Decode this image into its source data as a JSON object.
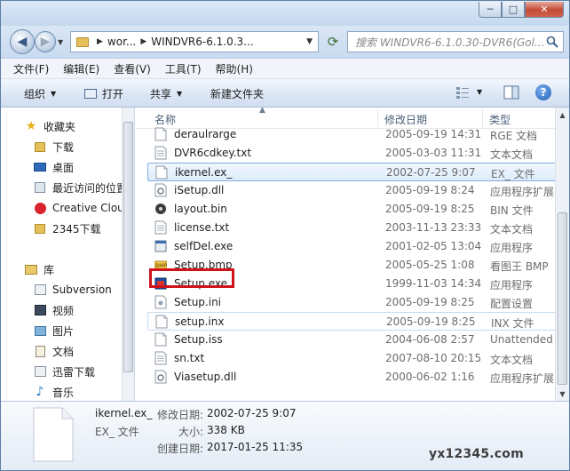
{
  "titlebar": {
    "minimize_glyph": "─",
    "maximize_glyph": "□",
    "close_glyph": "✕"
  },
  "nav": {
    "back_glyph": "◀",
    "forward_glyph": "▶",
    "history_glyph": "▼",
    "address_segments": [
      "wor...",
      "WINDVR6-6.1.0.3..."
    ],
    "address_separator": "▶",
    "address_dropdown_glyph": "▼",
    "refresh_glyph": "⟳",
    "search_placeholder": "搜索 WINDVR6-6.1.0.30-DVR6(Gol..."
  },
  "menu": {
    "items": [
      "文件(F)",
      "编辑(E)",
      "查看(V)",
      "工具(T)",
      "帮助(H)"
    ]
  },
  "toolbar": {
    "organize": "组织",
    "open": "打开",
    "share": "共享",
    "new_folder": "新建文件夹",
    "dropdown_glyph": "▼",
    "help_glyph": "?"
  },
  "sidebar": {
    "items": [
      {
        "label": "收藏夹",
        "icon": "star-icon"
      },
      {
        "label": "下载",
        "icon": "folder-icon"
      },
      {
        "label": "桌面",
        "icon": "desktop-icon"
      },
      {
        "label": "最近访问的位置",
        "icon": "recent-icon"
      },
      {
        "label": "Creative Cloud",
        "icon": "creative-cloud-icon"
      },
      {
        "label": "2345下载",
        "icon": "folder-icon"
      },
      {
        "label": "库",
        "icon": "library-icon"
      },
      {
        "label": "Subversion",
        "icon": "library-folder-icon"
      },
      {
        "label": "视频",
        "icon": "video-icon"
      },
      {
        "label": "图片",
        "icon": "pictures-icon"
      },
      {
        "label": "文档",
        "icon": "documents-icon"
      },
      {
        "label": "迅雷下载",
        "icon": "library-folder-icon"
      },
      {
        "label": "音乐",
        "icon": "music-icon"
      }
    ]
  },
  "columns": {
    "name": "名称",
    "modified": "修改日期",
    "type": "类型"
  },
  "files": [
    {
      "name": "deraulrarge",
      "date": "2005-09-19 14:31",
      "type": "RGE 文档",
      "icon": "generic-file-icon"
    },
    {
      "name": "DVR6cdkey.txt",
      "date": "2005-03-03 11:31",
      "type": "文本文档",
      "icon": "text-file-icon"
    },
    {
      "name": "ikernel.ex_",
      "date": "2002-07-25 9:07",
      "type": "EX_ 文件",
      "icon": "generic-file-icon"
    },
    {
      "name": "iSetup.dll",
      "date": "2005-09-19 8:24",
      "type": "应用程序扩展",
      "icon": "dll-file-icon"
    },
    {
      "name": "layout.bin",
      "date": "2005-09-19 8:25",
      "type": "BIN 文件",
      "icon": "bin-file-icon"
    },
    {
      "name": "license.txt",
      "date": "2003-11-13 23:33",
      "type": "文本文档",
      "icon": "text-file-icon"
    },
    {
      "name": "selfDel.exe",
      "date": "2001-02-05 13:04",
      "type": "应用程序",
      "icon": "exe-file-icon"
    },
    {
      "name": "Setup.bmp",
      "date": "2005-05-25 1:08",
      "type": "看图王 BMP",
      "icon": "bmp-file-icon"
    },
    {
      "name": "Setup.exe",
      "date": "1999-11-03 14:34",
      "type": "应用程序",
      "icon": "setup-exe-icon"
    },
    {
      "name": "Setup.ini",
      "date": "2005-09-19 8:25",
      "type": "配置设置",
      "icon": "ini-file-icon"
    },
    {
      "name": "setup.inx",
      "date": "2005-09-19 8:25",
      "type": "INX 文件",
      "icon": "generic-file-icon"
    },
    {
      "name": "Setup.iss",
      "date": "2004-06-08 2:57",
      "type": "Unattended",
      "icon": "generic-file-icon"
    },
    {
      "name": "sn.txt",
      "date": "2007-08-10 20:15",
      "type": "文本文档",
      "icon": "text-file-icon"
    },
    {
      "name": "Viasetup.dll",
      "date": "2000-06-02 1:16",
      "type": "应用程序扩展",
      "icon": "dll-file-icon"
    }
  ],
  "details": {
    "filename": "ikernel.ex_",
    "filetype": "EX_ 文件",
    "modified_label": "修改日期:",
    "modified_value": "2002-07-25 9:07",
    "size_label": "大小:",
    "size_value": "338 KB",
    "created_label": "创建日期:",
    "created_value": "2017-01-25 11:35"
  },
  "watermark": "yx12345.com",
  "colors": {
    "highlight_box": "#d0121b",
    "selection_border": "#84acdd",
    "window_frame": "#c9dcef"
  }
}
